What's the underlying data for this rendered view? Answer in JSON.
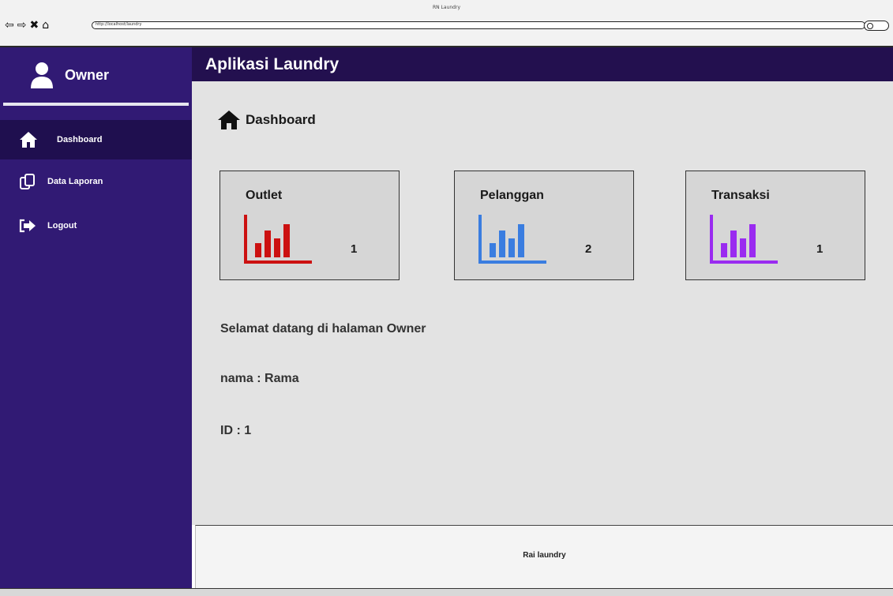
{
  "browser": {
    "window_title": "RN Laundry",
    "url": "http://localhost/laundry"
  },
  "sidebar": {
    "user_label": "Owner",
    "items": [
      {
        "label": "Dashboard",
        "icon": "home-icon",
        "active": true
      },
      {
        "label": "Data Laporan",
        "icon": "copy-icon",
        "active": false
      },
      {
        "label": "Logout",
        "icon": "logout-icon",
        "active": false
      }
    ]
  },
  "header": {
    "title": "Aplikasi Laundry"
  },
  "main": {
    "breadcrumb": "Dashboard",
    "cards": [
      {
        "label": "Outlet",
        "value": "1",
        "icon": "bar-chart-icon",
        "color": "#cc1111"
      },
      {
        "label": "Pelanggan",
        "value": "2",
        "icon": "bar-chart-icon",
        "color": "#3a7de0"
      },
      {
        "label": "Transaksi",
        "value": "1",
        "icon": "bar-chart-icon",
        "color": "#9a2bf0"
      }
    ],
    "welcome": "Selamat datang di halaman Owner",
    "name_line": "nama : Rama",
    "id_line": "ID : 1"
  },
  "footer": {
    "text": "Rai laundry"
  },
  "colors": {
    "sidebar_bg": "#311a74",
    "header_bg": "#23104f",
    "active_item_bg": "#1f0f4f",
    "main_bg": "#e3e3e3"
  }
}
